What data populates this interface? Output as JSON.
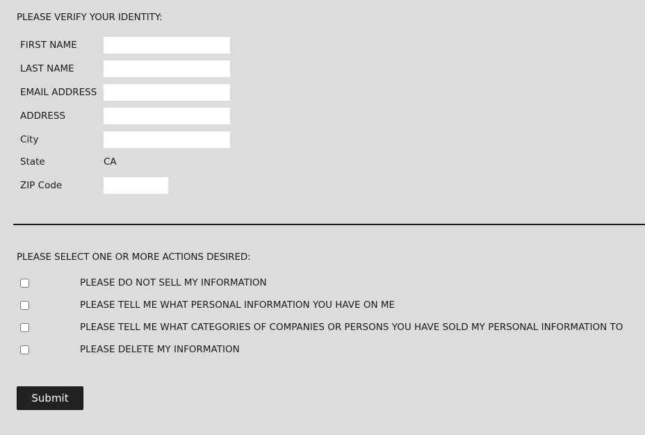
{
  "identity_section": {
    "heading": "PLEASE VERIFY YOUR IDENTITY:",
    "fields": [
      {
        "label": "FIRST NAME",
        "value": "",
        "placeholder": ""
      },
      {
        "label": "LAST NAME",
        "value": "",
        "placeholder": ""
      },
      {
        "label": "EMAIL ADDRESS",
        "value": "",
        "placeholder": ""
      },
      {
        "label": "ADDRESS",
        "value": "",
        "placeholder": ""
      },
      {
        "label": "City",
        "value": "",
        "placeholder": ""
      }
    ],
    "state": {
      "label": "State",
      "value": "CA"
    },
    "zip": {
      "label": "ZIP Code",
      "value": "",
      "placeholder": ""
    }
  },
  "actions_section": {
    "heading": "PLEASE SELECT ONE OR MORE ACTIONS DESIRED:",
    "options": [
      {
        "label": "PLEASE DO NOT SELL MY INFORMATION",
        "checked": false
      },
      {
        "label": "PLEASE TELL ME WHAT PERSONAL INFORMATION YOU HAVE ON ME",
        "checked": false
      },
      {
        "label": "PLEASE TELL ME WHAT CATEGORIES OF COMPANIES OR PERSONS YOU HAVE SOLD MY PERSONAL INFORMATION TO",
        "checked": false
      },
      {
        "label": "PLEASE DELETE MY INFORMATION",
        "checked": false
      }
    ]
  },
  "submit": {
    "label": "Submit"
  },
  "colors": {
    "background": "#dcdcdc",
    "input_background": "#ffffff",
    "button_background": "#222222",
    "button_text": "#ffffff",
    "text": "#1a1a1a"
  }
}
